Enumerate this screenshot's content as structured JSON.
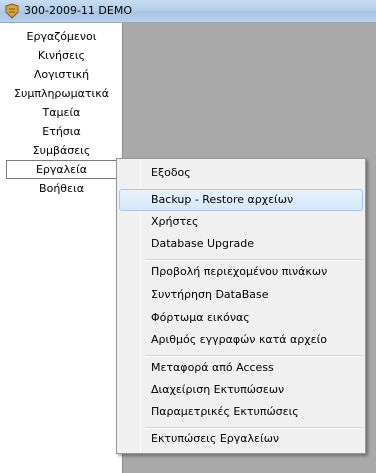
{
  "window": {
    "title": "300-2009-11 DEMO"
  },
  "left_menu": {
    "items": [
      "Εργαζόμενοι",
      "Κινήσεις",
      "Λογιστική",
      "Συμπληρωματικά",
      "Ταμεία",
      "Ετήσια",
      "Συμβάσεις",
      "Εργαλεία",
      "Βοήθεια"
    ],
    "active": "Εργαλεία"
  },
  "dropdown": {
    "items": [
      "Εξοδος",
      "Backup - Restore αρχείων",
      "Χρήστες",
      "Database Upgrade",
      "Προβολή περιεχομένου πινάκων",
      "Συντήρηση DataBase",
      "Φόρτωμα εικόνας",
      "Αριθμός εγγραφών κατά αρχείο",
      "Μεταφορά από Access",
      "Διαχείριση Εκτυπώσεων",
      "Παραμετρικές Εκτυπώσεις",
      "Εκτυπώσεις Εργαλείων"
    ],
    "highlighted": "Backup - Restore αρχείων"
  },
  "colors": {
    "workspace": "#a9a9a9",
    "highlight": "#d6e8fb",
    "menu_bg": "#f0f0f0"
  }
}
